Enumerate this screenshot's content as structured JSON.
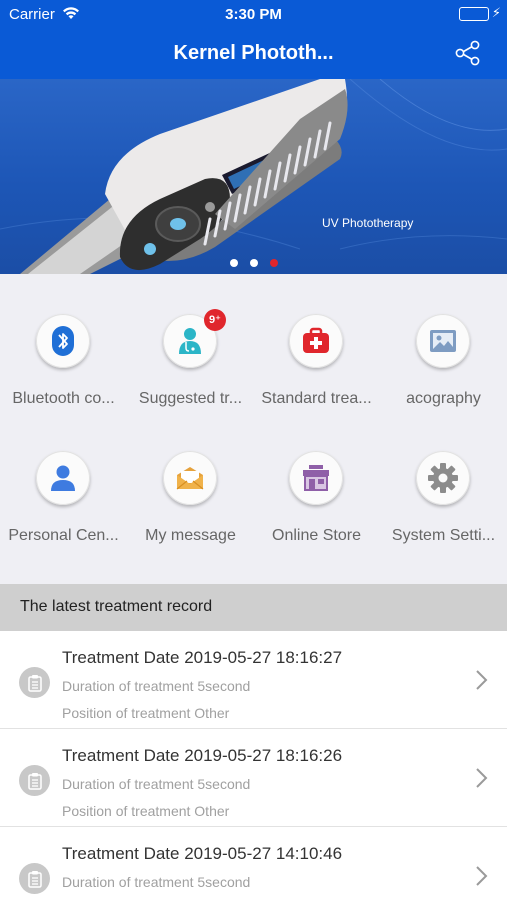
{
  "status_bar": {
    "carrier": "Carrier",
    "time": "3:30 PM",
    "wifi_icon": "wifi-icon",
    "battery_icon": "battery-icon"
  },
  "nav": {
    "title": "Kernel Phototh...",
    "share_icon": "share-icon"
  },
  "banner": {
    "caption": "UV Phototherapy",
    "slide_count": 3,
    "active_slide": 3
  },
  "menu": {
    "items": [
      {
        "label": "Bluetooth co...",
        "icon": "bluetooth-icon"
      },
      {
        "label": "Suggested tr...",
        "icon": "doctor-icon",
        "badge": "9⁺"
      },
      {
        "label": "Standard trea...",
        "icon": "first-aid-kit-icon"
      },
      {
        "label": "acography",
        "icon": "image-icon"
      },
      {
        "label": "Personal Cen...",
        "icon": "user-icon"
      },
      {
        "label": "My message",
        "icon": "envelope-icon"
      },
      {
        "label": "Online Store",
        "icon": "store-icon"
      },
      {
        "label": "System Setti...",
        "icon": "gear-icon"
      }
    ]
  },
  "records": {
    "header": "The latest treatment record",
    "items": [
      {
        "date": "Treatment Date 2019-05-27 18:16:27",
        "duration": "Duration of treatment 5second",
        "position": "Position of treatment Other"
      },
      {
        "date": "Treatment Date 2019-05-27 18:16:26",
        "duration": "Duration of treatment 5second",
        "position": "Position of treatment Other"
      },
      {
        "date": "Treatment Date 2019-05-27 14:10:46",
        "duration": "Duration of treatment 5second",
        "position": ""
      }
    ]
  },
  "colors": {
    "primary": "#0a5ad6",
    "badge": "#e0262c",
    "battery": "#4cd964"
  }
}
